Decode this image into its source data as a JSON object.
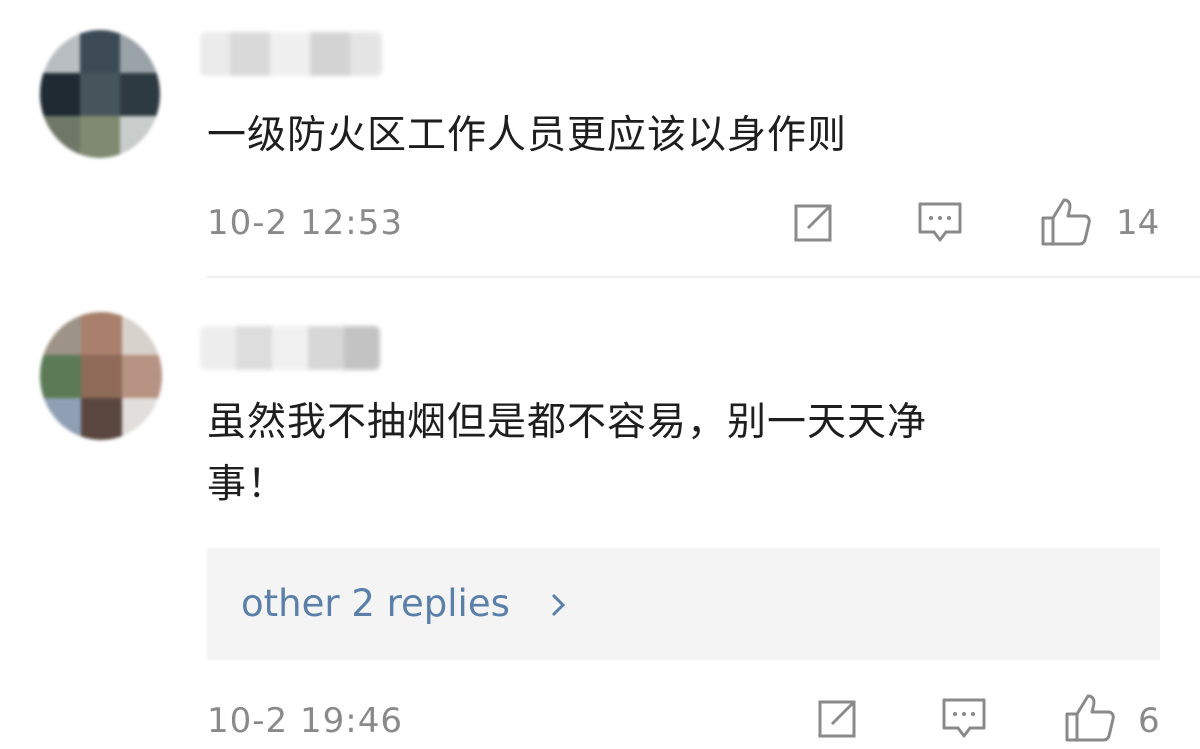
{
  "colors": {
    "text": "#1e1e1e",
    "meta": "#8a8a8a",
    "link": "#5a7fa8",
    "reply_bg": "#f4f4f4",
    "divider": "#eeeeee"
  },
  "comments": [
    {
      "text": "一级防火区工作人员更应该以身作则",
      "time": "10-2 12:53",
      "likes": "14",
      "icons": [
        "share-icon",
        "comment-icon",
        "like-icon"
      ]
    },
    {
      "text": "虽然我不抽烟但是都不容易，别一天天净\n事！",
      "time": "10-2 19:46",
      "likes": "6",
      "replies_label": "other 2 replies",
      "icons": [
        "share-icon",
        "comment-icon",
        "like-icon"
      ]
    }
  ]
}
